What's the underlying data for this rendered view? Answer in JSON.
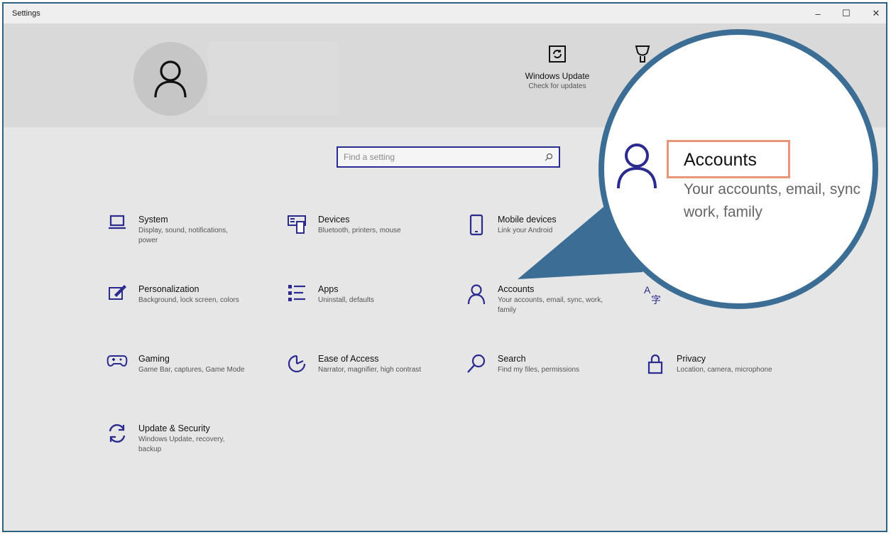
{
  "window": {
    "title": "Settings",
    "controls": {
      "minimize": "–",
      "maximize": "☐",
      "close": "✕"
    }
  },
  "quick_actions": [
    {
      "label": "Windows Update",
      "sub": "Check for updates",
      "icon": "sync-icon"
    }
  ],
  "search": {
    "placeholder": "Find a setting",
    "icon": "search-icon"
  },
  "tiles": [
    {
      "name": "System",
      "desc": "Display, sound, notifications, power",
      "icon": "laptop-icon"
    },
    {
      "name": "Devices",
      "desc": "Bluetooth, printers, mouse",
      "icon": "keyboard-icon"
    },
    {
      "name": "Mobile devices",
      "desc": "Link your Android",
      "icon": "phone-icon"
    },
    {
      "name": "Personalization",
      "desc": "Background, lock screen, colors",
      "icon": "paint-icon"
    },
    {
      "name": "Apps",
      "desc": "Uninstall, defaults",
      "icon": "apps-list-icon"
    },
    {
      "name": "Accounts",
      "desc": "Your accounts, email, sync, work, family",
      "icon": "person-icon"
    },
    {
      "name": "Gaming",
      "desc": "Game Bar, captures, Game Mode",
      "icon": "gamepad-icon"
    },
    {
      "name": "Ease of Access",
      "desc": "Narrator, magnifier, high contrast",
      "icon": "ease-of-access-icon"
    },
    {
      "name": "Search",
      "desc": "Find my files, permissions",
      "icon": "magnifier-icon"
    },
    {
      "name": "Privacy",
      "desc": "Location, camera, microphone",
      "icon": "lock-icon"
    },
    {
      "name": "Update & Security",
      "desc": "Windows Update, recovery, backup",
      "icon": "refresh-icon"
    }
  ],
  "zoom_callout": {
    "title": "Accounts",
    "desc_line1": "Your accounts, email, sync",
    "desc_line2": "work, family",
    "highlight_color": "#e8957a",
    "border_color": "#3c6d94"
  },
  "colors": {
    "accent": "#2b2a8f",
    "callout": "#3c6d94"
  }
}
